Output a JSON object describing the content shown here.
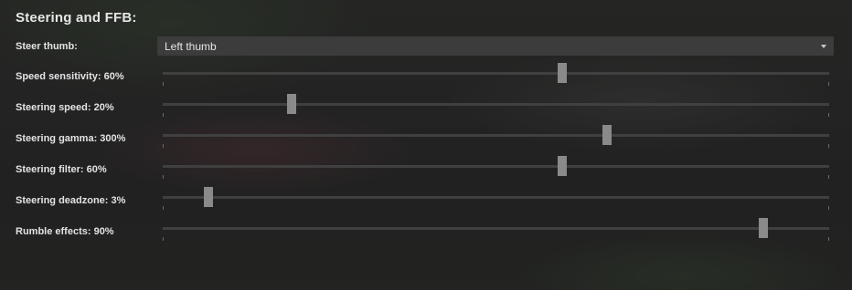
{
  "section_title": "Steering and FFB:",
  "steer_thumb": {
    "label": "Steer thumb:",
    "selected": "Left thumb"
  },
  "sliders": [
    {
      "label": "Speed sensitivity: 60%",
      "fraction": 0.6
    },
    {
      "label": "Steering speed: 20%",
      "fraction": 0.193
    },
    {
      "label": "Steering gamma: 300%",
      "fraction": 0.667
    },
    {
      "label": "Steering filter: 60%",
      "fraction": 0.6
    },
    {
      "label": "Steering deadzone: 3%",
      "fraction": 0.068
    },
    {
      "label": "Rumble effects: 90%",
      "fraction": 0.901
    }
  ]
}
